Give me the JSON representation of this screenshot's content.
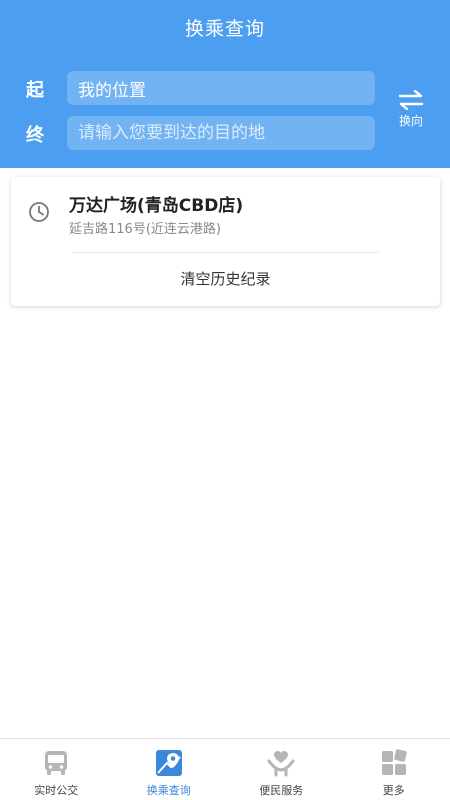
{
  "header": {
    "title": "换乘查询",
    "start_label": "起",
    "end_label": "终",
    "start_value": "我的位置",
    "end_placeholder": "请输入您要到达的目的地",
    "swap_label": "换向"
  },
  "history": {
    "items": [
      {
        "name": "万达广场(青岛CBD店)",
        "address": "延吉路116号(近连云港路)"
      }
    ],
    "clear_label": "清空历史纪录"
  },
  "tabs": [
    {
      "label": "实时公交",
      "icon": "bus-icon",
      "active": false
    },
    {
      "label": "换乘查询",
      "icon": "map-pin-icon",
      "active": true
    },
    {
      "label": "便民服务",
      "icon": "heart-hand-icon",
      "active": false
    },
    {
      "label": "更多",
      "icon": "grid-icon",
      "active": false
    }
  ],
  "colors": {
    "primary": "#4b9ef0",
    "active_tab": "#3b87d8",
    "inactive_icon": "#b5b5b5"
  }
}
